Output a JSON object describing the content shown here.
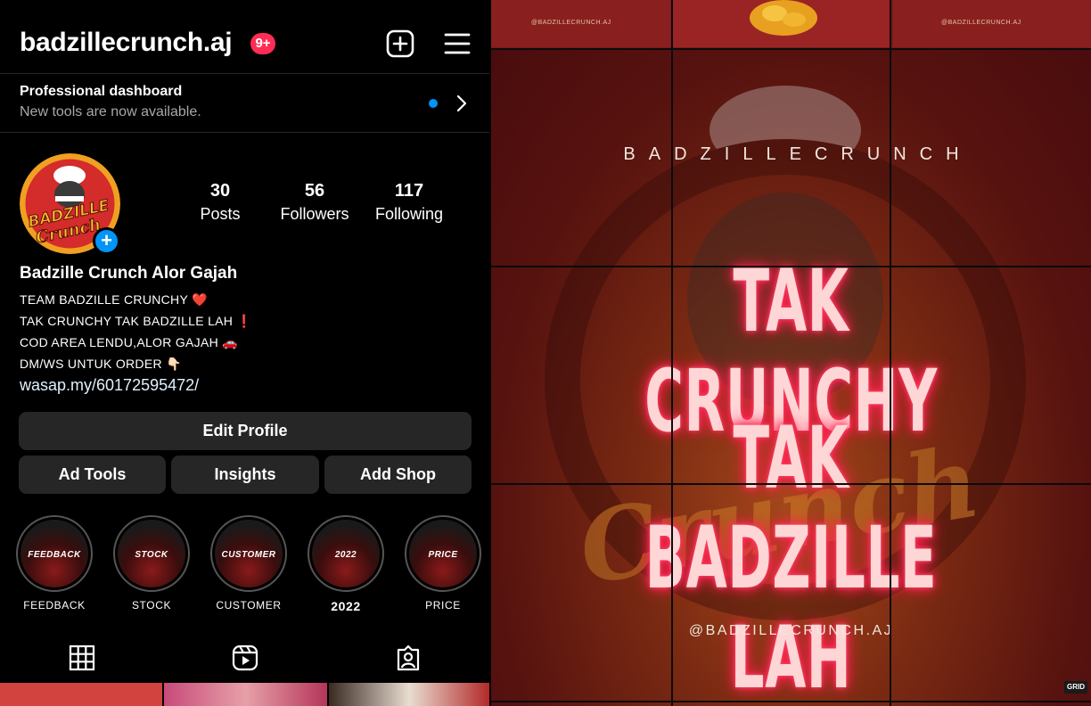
{
  "header": {
    "username": "badzillecrunch.aj",
    "notification_badge": "9+"
  },
  "dashboard": {
    "title": "Professional dashboard",
    "subtitle": "New tools are now available."
  },
  "stats": [
    {
      "num": "30",
      "label": "Posts"
    },
    {
      "num": "56",
      "label": "Followers"
    },
    {
      "num": "117",
      "label": "Following"
    }
  ],
  "bio": {
    "name": "Badzille Crunch Alor Gajah",
    "lines": [
      "TEAM BADZILLE CRUNCHY ❤️",
      "TAK CRUNCHY TAK BADZILLE LAH ❗",
      "COD AREA LENDU,ALOR GAJAH 🚗",
      "DM/WS UNTUK ORDER 👇🏻"
    ],
    "link": "wasap.my/60172595472/"
  },
  "buttons": {
    "edit_profile": "Edit Profile",
    "ad_tools": "Ad Tools",
    "insights": "Insights",
    "add_shop": "Add Shop"
  },
  "highlights": [
    {
      "cover": "FEEDBACK",
      "label": "FEEDBACK"
    },
    {
      "cover": "STOCK",
      "label": "STOCK"
    },
    {
      "cover": "CUSTOMER",
      "label": "CUSTOMER"
    },
    {
      "cover": "2022",
      "label": "2022"
    },
    {
      "cover": "PRICE",
      "label": "PRICE"
    }
  ],
  "tabs": [
    "grid-icon",
    "reels-icon",
    "tagged-icon"
  ],
  "post": {
    "watermark": "@BADZILLECRUNCH.AJ",
    "brand": "BADZILLECRUNCH",
    "headline_1": "TAK CRUNCHY",
    "headline_2": "TAK BADZILLE LAH",
    "handle": "@BADZILLECRUNCH.AJ",
    "grid_badge": "GRID"
  },
  "colors": {
    "accent_blue": "#0095f6",
    "badge_red": "#ff2d55",
    "button_bg": "#262626",
    "neon_pink": "#ff2050"
  }
}
